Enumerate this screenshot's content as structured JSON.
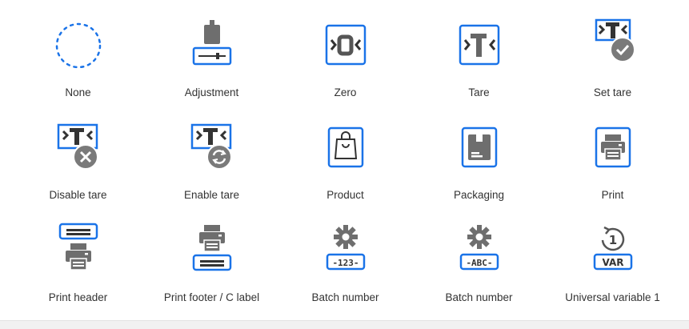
{
  "tiles": [
    {
      "label": "None",
      "icon": "none-dashed-circle-icon"
    },
    {
      "label": "Adjustment",
      "icon": "adjustment-weight-icon"
    },
    {
      "label": "Zero",
      "icon": "zero-icon"
    },
    {
      "label": "Tare",
      "icon": "tare-icon"
    },
    {
      "label": "Set tare",
      "icon": "set-tare-icon"
    },
    {
      "label": "Disable tare",
      "icon": "disable-tare-icon"
    },
    {
      "label": "Enable tare",
      "icon": "enable-tare-icon"
    },
    {
      "label": "Product",
      "icon": "product-bag-icon"
    },
    {
      "label": "Packaging",
      "icon": "packaging-box-icon"
    },
    {
      "label": "Print",
      "icon": "printer-icon"
    },
    {
      "label": "Print header",
      "icon": "print-header-icon"
    },
    {
      "label": "Print footer / C label",
      "icon": "print-footer-icon"
    },
    {
      "label": "Batch number",
      "icon": "batch-number-numeric-icon",
      "badge": "-123-"
    },
    {
      "label": "Batch number",
      "icon": "batch-number-alpha-icon",
      "badge": "-ABC-"
    },
    {
      "label": "Universal variable 1",
      "icon": "universal-variable-icon",
      "badge": "VAR",
      "digit": "1"
    }
  ],
  "colors": {
    "blue": "#1a73e8",
    "gray": "#6e6e6e",
    "badge_gray": "#7a7a7a",
    "light_bg": "#f5f5f5"
  }
}
